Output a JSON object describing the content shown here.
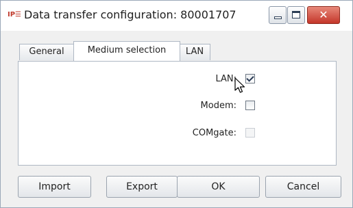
{
  "window": {
    "app_icon_text": "IP☰",
    "title": "Data transfer configuration: 80001707"
  },
  "title_controls": {
    "minimize_icon": "minimize-icon",
    "maximize_icon": "maximize-icon",
    "close_icon": "close-icon",
    "close_glyph": "✕",
    "close_color": "#c4362a"
  },
  "tabs": [
    {
      "label": "General",
      "active": false
    },
    {
      "label": "Medium selection",
      "active": true
    },
    {
      "label": "LAN",
      "active": false
    }
  ],
  "medium": {
    "lan": {
      "label": "LAN:",
      "checked": true,
      "enabled": true
    },
    "modem": {
      "label": "Modem:",
      "checked": false,
      "enabled": true
    },
    "comgate": {
      "label": "COMgate:",
      "checked": false,
      "enabled": false
    }
  },
  "buttons": {
    "import": "Import",
    "export": "Export",
    "ok": "OK",
    "cancel": "Cancel"
  }
}
